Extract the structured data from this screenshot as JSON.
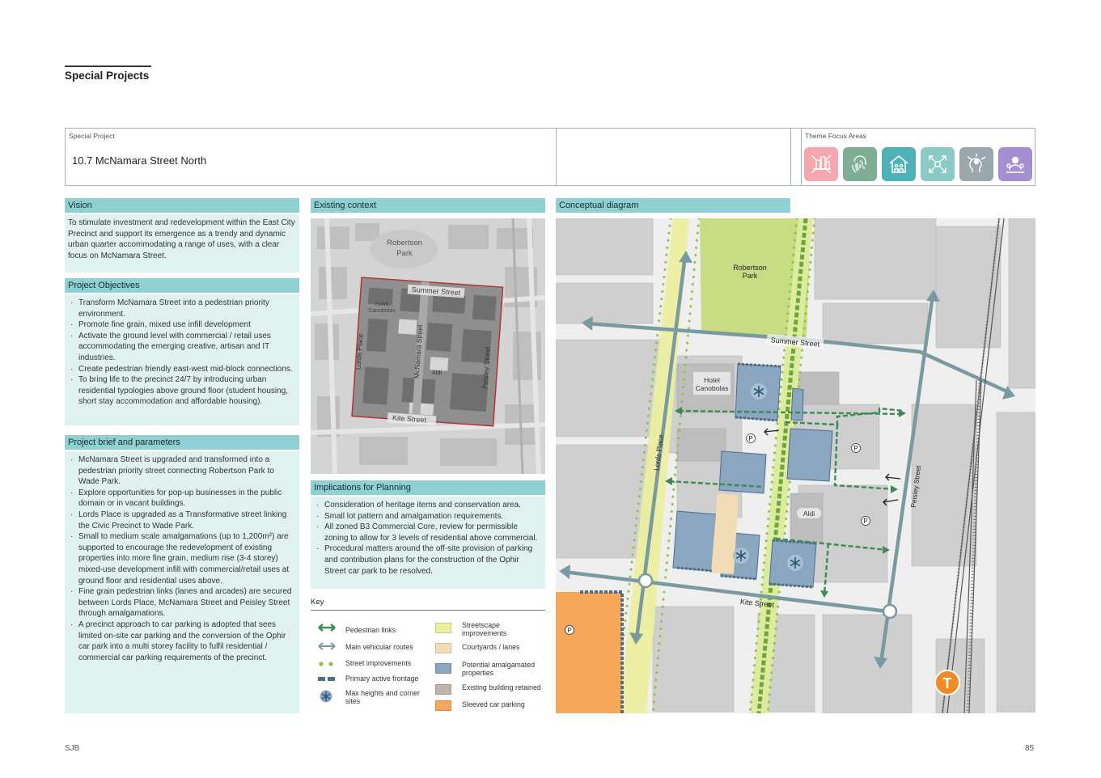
{
  "section_title": "Special Projects",
  "header": {
    "special_project_label": "Special Project",
    "project_title": "10.7  McNamara Street North",
    "theme_label": "Theme Focus Areas",
    "theme_icons": [
      {
        "icon": "city-skyline-icon",
        "color": "#f4a7ad"
      },
      {
        "icon": "fingerprint-icon",
        "color": "#7fae95"
      },
      {
        "icon": "community-house-icon",
        "color": "#4fb1b8"
      },
      {
        "icon": "expand-arrows-icon",
        "color": "#8ccac6"
      },
      {
        "icon": "head-ideas-icon",
        "color": "#9aa8ae"
      },
      {
        "icon": "people-meeting-icon",
        "color": "#a48fd0"
      }
    ]
  },
  "vision": {
    "heading": "Vision",
    "text": "To stimulate investment and redevelopment within the East City Precinct and support its emergence as a trendy and dynamic urban quarter accommodating a range of uses, with a clear focus on McNamara Street."
  },
  "objectives": {
    "heading": "Project Objectives",
    "items": [
      "Transform McNamara Street into a pedestrian priority environment.",
      "Promote fine grain, mixed use infill development",
      "Activate the ground level with commercial / retail uses accommodating the emerging creative, artisan and IT industries.",
      "Create pedestrian friendly east-west mid-block connections.",
      "To bring life to the precinct 24/7 by introducing urban residential typologies above ground floor (student housing, short stay accommodation and affordable housing)."
    ]
  },
  "brief": {
    "heading": "Project brief and parameters",
    "items": [
      "McNamara Street is upgraded and transformed into a pedestrian priority street connecting Robertson Park to Wade Park.",
      "Explore opportunities for pop-up businesses in the public domain or in vacant buildings.",
      "Lords Place is upgraded as a Transformative street linking the Civic Precinct to Wade Park.",
      "Small to medium scale amalgamations (up to 1,200m²) are supported to encourage the redevelopment of existing properties into more fine grain, medium rise (3-4 storey) mixed-use development infill with commercial/retail uses at ground floor and residential uses above.",
      "Fine grain pedestrian links (lanes and arcades) are secured between Lords Place, McNamara Street and Peisley Street through amalgamations.",
      "A precinct approach to car parking is adopted that sees limited on-site car parking and the conversion of the Ophir car park into a multi storey facility to fulfil residential / commercial car parking requirements of the precinct."
    ]
  },
  "context": {
    "heading": "Existing context",
    "labels": {
      "robertson_park": "Robertson Park",
      "summer_street": "Summer Street",
      "hotel": "Hotel Canobolas",
      "lords_place": "Lords Place",
      "mcnamara_street": "McNamara Street",
      "aldi": "Aldi",
      "peisley_street": "Peisley Street",
      "kite_street": "Kite Street"
    }
  },
  "implications": {
    "heading": "Implications for Planning",
    "items": [
      "Consideration of heritage items and conservation area.",
      "Small lot pattern and amalgamation requirements.",
      "All zoned B3 Commercial Core, review for permissible zoning to allow for 3 levels of residential above commercial.",
      "Procedural matters around the off-site provision of parking and contribution plans for the construction of the Ophir Street car park to be resolved."
    ]
  },
  "key": {
    "title": "Key",
    "left": [
      {
        "label": "Pedestrian links",
        "symbol": "double-arrow-green-icon",
        "color": "#3e8a54"
      },
      {
        "label": "Main vehicular routes",
        "symbol": "double-arrow-grey-icon",
        "color": "#7a9aa2"
      },
      {
        "label": "Street improvements",
        "symbol": "green-dots-icon",
        "color": "#8fc441"
      },
      {
        "label": "Primary active frontage",
        "symbol": "blue-dashes-icon",
        "color": "#4f6e8c"
      },
      {
        "label": "Max heights and corner sites",
        "symbol": "asterisk-icon",
        "color": "#5a8ca8"
      }
    ],
    "right": [
      {
        "label": "Streetscape improvements",
        "color": "#ecef9f"
      },
      {
        "label": "Courtyards / lanes",
        "color": "#f1dcb5"
      },
      {
        "label": "Potential amalgamated properties",
        "color": "#8aa6c1"
      },
      {
        "label": "Existing building retained",
        "color": "#c2b3ae"
      },
      {
        "label": "Sleeved car parking",
        "color": "#f6a75a"
      }
    ]
  },
  "diagram": {
    "heading": "Conceptual diagram",
    "labels": {
      "robertson_park": "Robertson Park",
      "summer_street": "Summer Street",
      "hotel": "Hotel Canobolas",
      "lords_place": "Lords Place",
      "aldi": "Aldi",
      "peisley_street": "Peisley Street",
      "kite_street": "Kite Street",
      "parking": "P",
      "train": "T"
    }
  },
  "footer": {
    "left": "SJB",
    "page": "85"
  }
}
